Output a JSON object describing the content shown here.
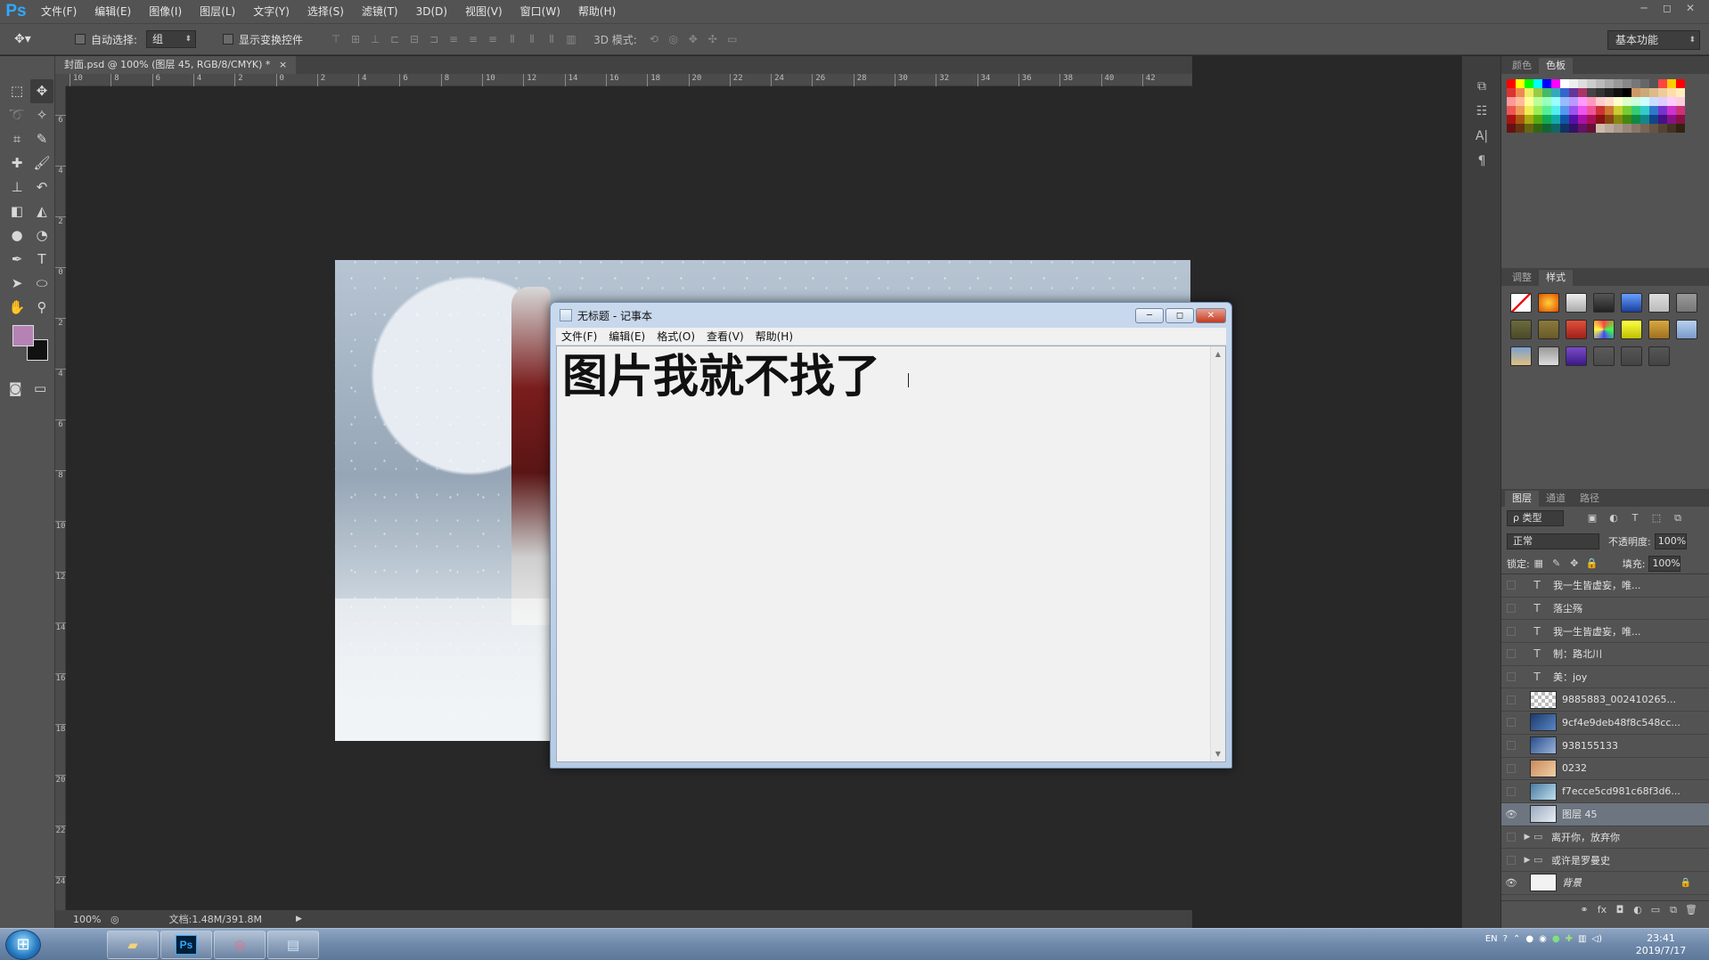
{
  "photoshop": {
    "logo": "Ps",
    "menu": [
      "文件(F)",
      "编辑(E)",
      "图像(I)",
      "图层(L)",
      "文字(Y)",
      "选择(S)",
      "滤镜(T)",
      "3D(D)",
      "视图(V)",
      "窗口(W)",
      "帮助(H)"
    ],
    "window_controls": [
      "─",
      "◻",
      "✕"
    ],
    "options": {
      "auto_select_label": "自动选择:",
      "auto_select_value": "组",
      "show_transform_label": "显示变换控件",
      "mode_3d_label": "3D 模式:",
      "workspace": "基本功能"
    },
    "document_tab": "封面.psd @ 100% (图层 45, RGB/8/CMYK) *",
    "ruler_h": [
      "10",
      "8",
      "6",
      "4",
      "2",
      "0",
      "2",
      "4",
      "6",
      "8",
      "10",
      "12",
      "14",
      "16",
      "18",
      "20",
      "22",
      "24",
      "26",
      "28",
      "30",
      "32",
      "34",
      "36",
      "38",
      "40",
      "42"
    ],
    "ruler_v": [
      "6",
      "4",
      "2",
      "0",
      "2",
      "4",
      "6",
      "8",
      "10",
      "12",
      "14",
      "16",
      "18",
      "20",
      "22",
      "24"
    ],
    "status": {
      "zoom": "100%",
      "doc_size": "文档:1.48M/391.8M"
    },
    "colors": {
      "foreground": "#b483b4",
      "background": "#111111"
    }
  },
  "panels": {
    "color_tabs": [
      "颜色",
      "色板"
    ],
    "adjust_tabs": [
      "调整",
      "样式"
    ],
    "layer_tabs": [
      "图层",
      "通道",
      "路径"
    ],
    "filter_kind": "ρ 类型",
    "blend_mode": "正常",
    "opacity_label": "不透明度:",
    "opacity_value": "100%",
    "lock_label": "锁定:",
    "fill_label": "填充:",
    "fill_value": "100%",
    "layers": [
      {
        "kind": "text",
        "name": "我一生皆虚妄，唯...",
        "visible": false
      },
      {
        "kind": "text",
        "name": "落尘殇",
        "visible": false
      },
      {
        "kind": "text",
        "name": "我一生皆虚妄，唯...",
        "visible": false
      },
      {
        "kind": "text",
        "name": "制：路北川",
        "visible": false
      },
      {
        "kind": "text",
        "name": "美：joy",
        "visible": false
      },
      {
        "kind": "image",
        "name": "9885883_002410265...",
        "visible": false
      },
      {
        "kind": "image",
        "name": "9cf4e9deb48f8c548cc...",
        "visible": false
      },
      {
        "kind": "image",
        "name": "938155133",
        "visible": false
      },
      {
        "kind": "image",
        "name": "0232",
        "visible": false
      },
      {
        "kind": "image",
        "name": "f7ecce5cd981c68f3d6...",
        "visible": false
      },
      {
        "kind": "image",
        "name": "图层 45",
        "visible": true,
        "selected": true
      },
      {
        "kind": "group",
        "name": "离开你，放弃你",
        "visible": false
      },
      {
        "kind": "group",
        "name": "或许是罗曼史",
        "visible": false
      },
      {
        "kind": "background",
        "name": "背景",
        "visible": true
      }
    ]
  },
  "notepad": {
    "title": "无标题 - 记事本",
    "menu": [
      "文件(F)",
      "编辑(E)",
      "格式(O)",
      "查看(V)",
      "帮助(H)"
    ],
    "content": "图片我就不找了",
    "controls": [
      "─",
      "◻",
      "✕"
    ]
  },
  "taskbar": {
    "ps_badge": "Ps",
    "language": "EN",
    "time": "23:41",
    "date": "2019/7/17"
  }
}
